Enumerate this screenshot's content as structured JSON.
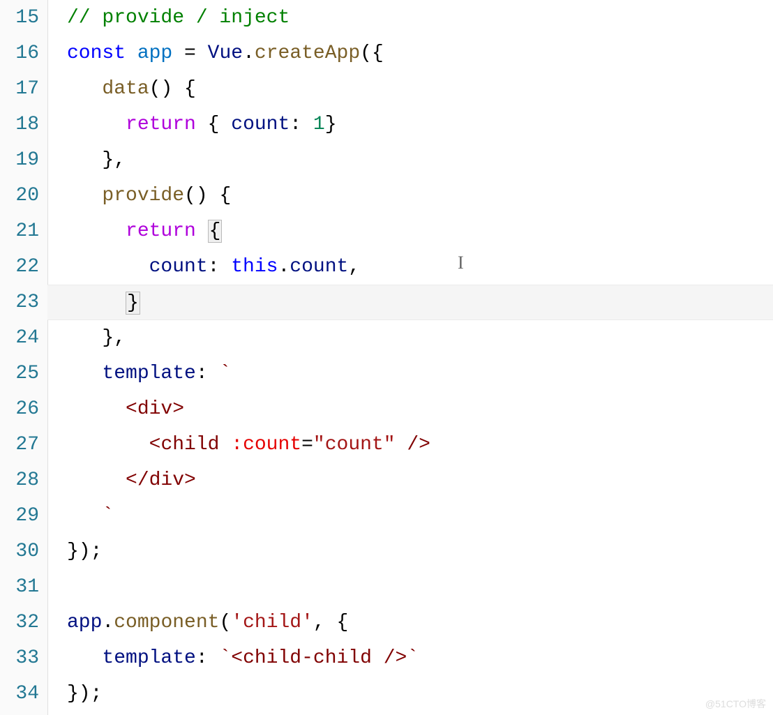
{
  "lineNumbers": [
    "15",
    "16",
    "17",
    "18",
    "19",
    "20",
    "21",
    "22",
    "23",
    "24",
    "25",
    "26",
    "27",
    "28",
    "29",
    "30",
    "31",
    "32",
    "33",
    "34"
  ],
  "code": {
    "l15": {
      "comment": "// provide / inject"
    },
    "l16": {
      "kw": "const",
      "var": "app",
      "eq": " = ",
      "obj": "Vue",
      "dot": ".",
      "fn": "createApp",
      "open": "({"
    },
    "l17": {
      "fn": "data",
      "rest": "() {"
    },
    "l18": {
      "ret": "return",
      "open": " { ",
      "prop": "count",
      "colon": ": ",
      "num": "1",
      "close": "}"
    },
    "l19": {
      "close": "},"
    },
    "l20": {
      "fn": "provide",
      "rest": "() {"
    },
    "l21": {
      "ret": "return",
      "sp": " ",
      "brace": "{"
    },
    "l22": {
      "prop": "count",
      "colon": ": ",
      "this": "this",
      "dot": ".",
      "member": "count",
      "comma": ","
    },
    "l23": {
      "brace": "}"
    },
    "l24": {
      "close": "},"
    },
    "l25": {
      "prop": "template",
      "colon": ": ",
      "tick": "`"
    },
    "l26": {
      "open": "<",
      "tag": "div",
      "close": ">"
    },
    "l27": {
      "open": "<",
      "tag": "child",
      "sp": " ",
      "attr": ":count",
      "eq": "=",
      "val": "\"count\"",
      "selfclose": " />"
    },
    "l28": {
      "open": "</",
      "tag": "div",
      "close": ">"
    },
    "l29": {
      "tick": "`"
    },
    "l30": {
      "close": "});"
    },
    "l31": {
      "blank": ""
    },
    "l32": {
      "obj": "app",
      "dot": ".",
      "fn": "component",
      "open": "(",
      "str": "'child'",
      "rest": ", {"
    },
    "l33": {
      "prop": "template",
      "colon": ": ",
      "tick1": "`",
      "open": "<",
      "tag": "child-child",
      "selfclose": " />",
      "tick2": "`"
    },
    "l34": {
      "close": "});"
    }
  },
  "watermark": "@51CTO博客"
}
